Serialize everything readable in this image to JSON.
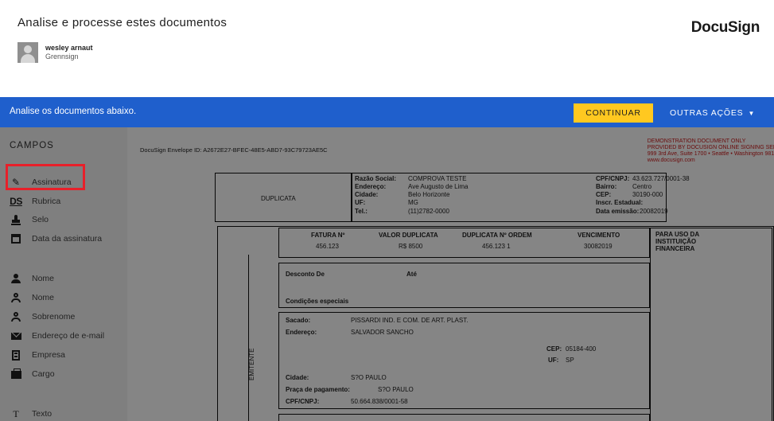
{
  "header": {
    "title": "Analise e processe estes documentos",
    "logo": "DocuSign",
    "sender_name": "wesley arnaut",
    "sender_company": "Grennsign"
  },
  "actionbar": {
    "message": "Analise os documentos abaixo.",
    "continue_label": "CONTINUAR",
    "other_actions_label": "OUTRAS AÇÕES"
  },
  "sidebar": {
    "heading": "CAMPOS",
    "fields": [
      {
        "label": "Assinatura",
        "icon": "pen-icon"
      },
      {
        "label": "Rubrica",
        "icon": "ds-initials-icon"
      },
      {
        "label": "Selo",
        "icon": "stamp-icon"
      },
      {
        "label": "Data da assinatura",
        "icon": "calendar-icon"
      },
      {
        "label": "Nome",
        "icon": "person-icon"
      },
      {
        "label": "Nome",
        "icon": "person-outline-icon"
      },
      {
        "label": "Sobrenome",
        "icon": "person-outline-icon"
      },
      {
        "label": "Endereço de e-mail",
        "icon": "mail-icon"
      },
      {
        "label": "Empresa",
        "icon": "building-icon"
      },
      {
        "label": "Cargo",
        "icon": "briefcase-icon"
      },
      {
        "label": "Texto",
        "icon": "text-icon"
      }
    ]
  },
  "document": {
    "envelope_id": "DocuSign Envelope ID: A2672E27-BFEC-48E5-ABD7-93C79723AE5C",
    "demo_lines": [
      "DEMONSTRATION DOCUMENT ONLY",
      "PROVIDED BY DOCUSIGN ONLINE SIGNING SER",
      "999 3rd Ave, Suite 1700 • Seattle • Washington 981",
      "www.docusign.com"
    ],
    "duplicata_label": "DUPLICATA",
    "company": {
      "razao_label": "Razão Social:",
      "razao": "COMPROVA TESTE",
      "endereco_label": "Endereço:",
      "endereco": "Ave Augusto de Lima",
      "cidade_label": "Cidade:",
      "cidade": "Belo Horizonte",
      "uf_label": "UF:",
      "uf": "MG",
      "tel_label": "Tel.:",
      "tel": "(11)2782-0000",
      "cnpj_label": "CPF/CNPJ:",
      "cnpj": "43.623.727/0001-38",
      "bairro_label": "Bairro:",
      "bairro": "Centro",
      "cep_label": "CEP:",
      "cep": "30190-000",
      "inscr_label": "Inscr. Estadual:",
      "emissao_label": "Data emissão:",
      "emissao": "20082019"
    },
    "invoice": {
      "fatura_label": "FATURA Nº",
      "fatura": "456.123",
      "valor_label": "VALOR DUPLICATA",
      "valor": "R$ 8500",
      "ordem_label": "DUPLICATA Nº ORDEM",
      "ordem": "456.123 1",
      "venc_label": "VENCIMENTO",
      "venc": "30082019",
      "instituicao_label_1": "PARA USO DA",
      "instituicao_label_2": "INSTITUIÇÃO",
      "instituicao_label_3": "FINANCEIRA"
    },
    "desconto_label": "Desconto  De",
    "ate_label": "Até",
    "condicoes_label": "Condições especiais",
    "sacado": {
      "sacado_label": "Sacado:",
      "sacado": "PISSARDI IND. E COM. DE ART. PLAST.",
      "endereco_label": "Endereço:",
      "endereco": "SALVADOR SANCHO",
      "cep_label": "CEP:",
      "cep": "05184-400",
      "uf_label": "UF:",
      "uf": "SP",
      "cidade_label": "Cidade:",
      "cidade": "S?O PAULO",
      "praca_label": "Praça de pagamento:",
      "praca": "S?O PAULO",
      "cnpj_label": "CPF/CNPJ:",
      "cnpj": "50.664.838/0001-58"
    },
    "emitente_label": "EMITENTE"
  }
}
